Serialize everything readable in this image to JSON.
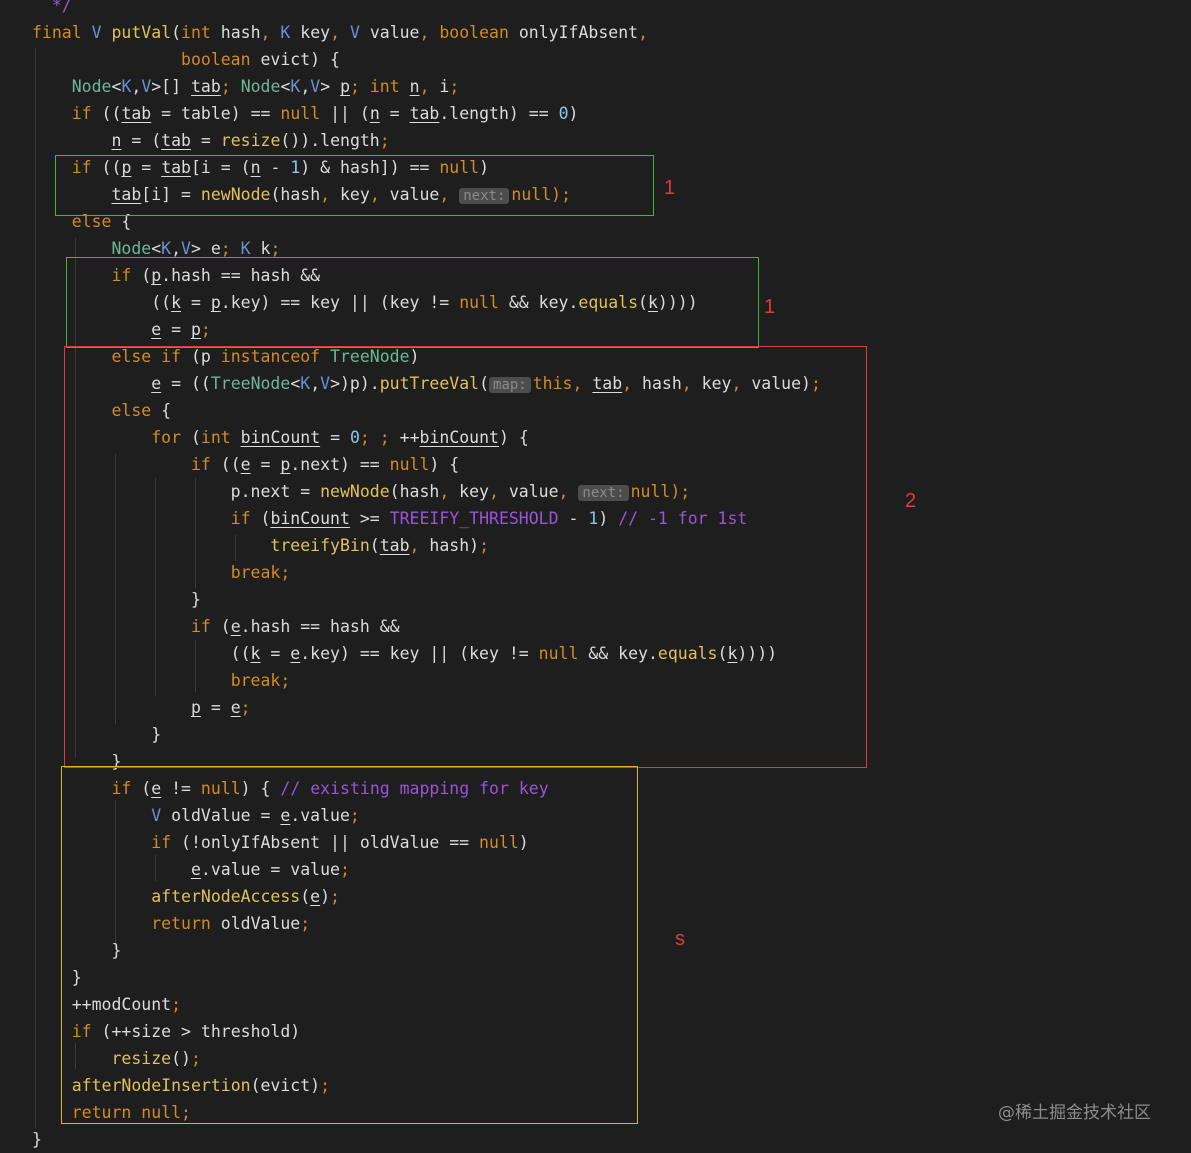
{
  "code_lines": [
    [
      {
        "t": "  */",
        "c": "cmt"
      }
    ],
    [
      {
        "t": "final",
        "c": "kw"
      },
      {
        "t": " "
      },
      {
        "t": "V",
        "c": "gen"
      },
      {
        "t": " "
      },
      {
        "t": "putVal",
        "c": "fn"
      },
      {
        "t": "("
      },
      {
        "t": "int",
        "c": "kw"
      },
      {
        "t": " hash"
      },
      {
        "t": ",",
        "c": "pun"
      },
      {
        "t": " "
      },
      {
        "t": "K",
        "c": "gen"
      },
      {
        "t": " key"
      },
      {
        "t": ",",
        "c": "pun"
      },
      {
        "t": " "
      },
      {
        "t": "V",
        "c": "gen"
      },
      {
        "t": " value"
      },
      {
        "t": ",",
        "c": "pun"
      },
      {
        "t": " "
      },
      {
        "t": "boolean",
        "c": "kw"
      },
      {
        "t": " onlyIfAbsent"
      },
      {
        "t": ",",
        "c": "pun"
      }
    ],
    [
      {
        "t": "               "
      },
      {
        "t": "boolean",
        "c": "kw"
      },
      {
        "t": " evict) {"
      }
    ],
    [
      {
        "t": "    "
      },
      {
        "t": "Node",
        "c": "ty"
      },
      {
        "t": "<"
      },
      {
        "t": "K",
        "c": "gen"
      },
      {
        "t": ","
      },
      {
        "t": "V",
        "c": "gen"
      },
      {
        "t": ">[] "
      },
      {
        "t": "tab",
        "c": "u"
      },
      {
        "t": ";",
        "c": "pun"
      },
      {
        "t": " "
      },
      {
        "t": "Node",
        "c": "ty"
      },
      {
        "t": "<"
      },
      {
        "t": "K",
        "c": "gen"
      },
      {
        "t": ","
      },
      {
        "t": "V",
        "c": "gen"
      },
      {
        "t": "> "
      },
      {
        "t": "p",
        "c": "u"
      },
      {
        "t": ";",
        "c": "pun"
      },
      {
        "t": " "
      },
      {
        "t": "int",
        "c": "kw"
      },
      {
        "t": " "
      },
      {
        "t": "n",
        "c": "u"
      },
      {
        "t": ",",
        "c": "pun"
      },
      {
        "t": " i"
      },
      {
        "t": ";",
        "c": "pun"
      }
    ],
    [
      {
        "t": "    "
      },
      {
        "t": "if",
        "c": "kw"
      },
      {
        "t": " (("
      },
      {
        "t": "tab",
        "c": "u"
      },
      {
        "t": " = table) == "
      },
      {
        "t": "null",
        "c": "kw"
      },
      {
        "t": " || ("
      },
      {
        "t": "n",
        "c": "u"
      },
      {
        "t": " = "
      },
      {
        "t": "tab",
        "c": "u"
      },
      {
        "t": ".length) == "
      },
      {
        "t": "0",
        "c": "num"
      },
      {
        "t": ")"
      }
    ],
    [
      {
        "t": "        "
      },
      {
        "t": "n",
        "c": "u"
      },
      {
        "t": " = ("
      },
      {
        "t": "tab",
        "c": "u"
      },
      {
        "t": " = "
      },
      {
        "t": "resize",
        "c": "fn"
      },
      {
        "t": "()).length"
      },
      {
        "t": ";",
        "c": "pun"
      }
    ],
    [
      {
        "t": "    "
      },
      {
        "t": "if",
        "c": "kw"
      },
      {
        "t": " (("
      },
      {
        "t": "p",
        "c": "u"
      },
      {
        "t": " = "
      },
      {
        "t": "tab",
        "c": "u"
      },
      {
        "t": "[i = ("
      },
      {
        "t": "n",
        "c": "u"
      },
      {
        "t": " - "
      },
      {
        "t": "1",
        "c": "num"
      },
      {
        "t": ") & hash]) == "
      },
      {
        "t": "null",
        "c": "kw"
      },
      {
        "t": ")"
      }
    ],
    [
      {
        "t": "        "
      },
      {
        "t": "tab",
        "c": "u"
      },
      {
        "t": "[i] = "
      },
      {
        "t": "newNode",
        "c": "fn"
      },
      {
        "t": "(hash"
      },
      {
        "t": ",",
        "c": "pun"
      },
      {
        "t": " key"
      },
      {
        "t": ",",
        "c": "pun"
      },
      {
        "t": " value"
      },
      {
        "t": ",",
        "c": "pun"
      },
      {
        "t": " "
      },
      {
        "t": "next:",
        "c": "hint"
      },
      {
        "t": "null",
        "c": "kw"
      },
      {
        "t": ");",
        "c": "pun"
      }
    ],
    [
      {
        "t": "    "
      },
      {
        "t": "else",
        "c": "kw"
      },
      {
        "t": " {"
      }
    ],
    [
      {
        "t": "        "
      },
      {
        "t": "Node",
        "c": "ty"
      },
      {
        "t": "<"
      },
      {
        "t": "K",
        "c": "gen"
      },
      {
        "t": ","
      },
      {
        "t": "V",
        "c": "gen"
      },
      {
        "t": "> "
      },
      {
        "t": "e",
        "c": "u"
      },
      {
        "t": ";",
        "c": "pun"
      },
      {
        "t": " "
      },
      {
        "t": "K",
        "c": "gen"
      },
      {
        "t": " "
      },
      {
        "t": "k",
        "c": "u"
      },
      {
        "t": ";",
        "c": "pun"
      }
    ],
    [
      {
        "t": "        "
      },
      {
        "t": "if",
        "c": "kw"
      },
      {
        "t": " ("
      },
      {
        "t": "p",
        "c": "u"
      },
      {
        "t": ".hash == hash &&"
      }
    ],
    [
      {
        "t": "            (("
      },
      {
        "t": "k",
        "c": "u"
      },
      {
        "t": " = "
      },
      {
        "t": "p",
        "c": "u"
      },
      {
        "t": ".key) == key || (key != "
      },
      {
        "t": "null",
        "c": "kw"
      },
      {
        "t": " && key."
      },
      {
        "t": "equals",
        "c": "fn"
      },
      {
        "t": "("
      },
      {
        "t": "k",
        "c": "u"
      },
      {
        "t": "))))"
      }
    ],
    [
      {
        "t": "            "
      },
      {
        "t": "e",
        "c": "u"
      },
      {
        "t": " = "
      },
      {
        "t": "p",
        "c": "u"
      },
      {
        "t": ";",
        "c": "pun"
      }
    ],
    [
      {
        "t": "        "
      },
      {
        "t": "else if",
        "c": "kw"
      },
      {
        "t": " (p "
      },
      {
        "t": "instanceof",
        "c": "kw"
      },
      {
        "t": " "
      },
      {
        "t": "TreeNode",
        "c": "ty"
      },
      {
        "t": ")"
      }
    ],
    [
      {
        "t": "            "
      },
      {
        "t": "e",
        "c": "u"
      },
      {
        "t": " = (("
      },
      {
        "t": "TreeNode",
        "c": "ty"
      },
      {
        "t": "<"
      },
      {
        "t": "K",
        "c": "gen"
      },
      {
        "t": ","
      },
      {
        "t": "V",
        "c": "gen"
      },
      {
        "t": ">)p)."
      },
      {
        "t": "putTreeVal",
        "c": "fn"
      },
      {
        "t": "("
      },
      {
        "t": "map:",
        "c": "hint"
      },
      {
        "t": "this",
        "c": "kw"
      },
      {
        "t": ",",
        "c": "pun"
      },
      {
        "t": " "
      },
      {
        "t": "tab",
        "c": "u"
      },
      {
        "t": ",",
        "c": "pun"
      },
      {
        "t": " hash"
      },
      {
        "t": ",",
        "c": "pun"
      },
      {
        "t": " key"
      },
      {
        "t": ",",
        "c": "pun"
      },
      {
        "t": " value)"
      },
      {
        "t": ";",
        "c": "pun"
      }
    ],
    [
      {
        "t": "        "
      },
      {
        "t": "else",
        "c": "kw"
      },
      {
        "t": " {"
      }
    ],
    [
      {
        "t": "            "
      },
      {
        "t": "for",
        "c": "kw"
      },
      {
        "t": " ("
      },
      {
        "t": "int",
        "c": "kw"
      },
      {
        "t": " "
      },
      {
        "t": "binCount",
        "c": "u"
      },
      {
        "t": " = "
      },
      {
        "t": "0",
        "c": "num"
      },
      {
        "t": ";",
        "c": "pun"
      },
      {
        "t": " ",
        "c": ""
      },
      {
        "t": ";",
        "c": "pun"
      },
      {
        "t": " ++"
      },
      {
        "t": "binCount",
        "c": "u"
      },
      {
        "t": ") {"
      }
    ],
    [
      {
        "t": "                "
      },
      {
        "t": "if",
        "c": "kw"
      },
      {
        "t": " (("
      },
      {
        "t": "e",
        "c": "u"
      },
      {
        "t": " = "
      },
      {
        "t": "p",
        "c": "u"
      },
      {
        "t": ".next) == "
      },
      {
        "t": "null",
        "c": "kw"
      },
      {
        "t": ") {"
      }
    ],
    [
      {
        "t": "                    p.next = "
      },
      {
        "t": "newNode",
        "c": "fn"
      },
      {
        "t": "(hash"
      },
      {
        "t": ",",
        "c": "pun"
      },
      {
        "t": " key"
      },
      {
        "t": ",",
        "c": "pun"
      },
      {
        "t": " value"
      },
      {
        "t": ",",
        "c": "pun"
      },
      {
        "t": " "
      },
      {
        "t": "next:",
        "c": "hint"
      },
      {
        "t": "null",
        "c": "kw"
      },
      {
        "t": ");",
        "c": "pun"
      }
    ],
    [
      {
        "t": "                    "
      },
      {
        "t": "if",
        "c": "kw"
      },
      {
        "t": " ("
      },
      {
        "t": "binCount",
        "c": "u"
      },
      {
        "t": " >= "
      },
      {
        "t": "TREEIFY_THRESHOLD",
        "c": "cmt"
      },
      {
        "t": " - "
      },
      {
        "t": "1",
        "c": "num"
      },
      {
        "t": ") "
      },
      {
        "t": "// -1 for 1st",
        "c": "cmt"
      }
    ],
    [
      {
        "t": "                        "
      },
      {
        "t": "treeifyBin",
        "c": "fn"
      },
      {
        "t": "("
      },
      {
        "t": "tab",
        "c": "u"
      },
      {
        "t": ",",
        "c": "pun"
      },
      {
        "t": " hash)"
      },
      {
        "t": ";",
        "c": "pun"
      }
    ],
    [
      {
        "t": "                    "
      },
      {
        "t": "break",
        "c": "kw"
      },
      {
        "t": ";",
        "c": "pun"
      }
    ],
    [
      {
        "t": "                }"
      }
    ],
    [
      {
        "t": "                "
      },
      {
        "t": "if",
        "c": "kw"
      },
      {
        "t": " ("
      },
      {
        "t": "e",
        "c": "u"
      },
      {
        "t": ".hash == hash &&"
      }
    ],
    [
      {
        "t": "                    (("
      },
      {
        "t": "k",
        "c": "u"
      },
      {
        "t": " = "
      },
      {
        "t": "e",
        "c": "u"
      },
      {
        "t": ".key) == key || (key != "
      },
      {
        "t": "null",
        "c": "kw"
      },
      {
        "t": " && key."
      },
      {
        "t": "equals",
        "c": "fn"
      },
      {
        "t": "("
      },
      {
        "t": "k",
        "c": "u"
      },
      {
        "t": "))))"
      }
    ],
    [
      {
        "t": "                    "
      },
      {
        "t": "break",
        "c": "kw"
      },
      {
        "t": ";",
        "c": "pun"
      }
    ],
    [
      {
        "t": "                "
      },
      {
        "t": "p",
        "c": "u"
      },
      {
        "t": " = "
      },
      {
        "t": "e",
        "c": "u"
      },
      {
        "t": ";",
        "c": "pun"
      }
    ],
    [
      {
        "t": "            }"
      }
    ],
    [
      {
        "t": "        }"
      }
    ],
    [
      {
        "t": "        "
      },
      {
        "t": "if",
        "c": "kw"
      },
      {
        "t": " ("
      },
      {
        "t": "e",
        "c": "u"
      },
      {
        "t": " != "
      },
      {
        "t": "null",
        "c": "kw"
      },
      {
        "t": ") { "
      },
      {
        "t": "// existing mapping for key",
        "c": "cmt"
      }
    ],
    [
      {
        "t": "            "
      },
      {
        "t": "V",
        "c": "gen"
      },
      {
        "t": " oldValue = "
      },
      {
        "t": "e",
        "c": "u"
      },
      {
        "t": ".value"
      },
      {
        "t": ";",
        "c": "pun"
      }
    ],
    [
      {
        "t": "            "
      },
      {
        "t": "if",
        "c": "kw"
      },
      {
        "t": " (!onlyIfAbsent || oldValue == "
      },
      {
        "t": "null",
        "c": "kw"
      },
      {
        "t": ")"
      }
    ],
    [
      {
        "t": "                "
      },
      {
        "t": "e",
        "c": "u"
      },
      {
        "t": ".value = value"
      },
      {
        "t": ";",
        "c": "pun"
      }
    ],
    [
      {
        "t": "            "
      },
      {
        "t": "afterNodeAccess",
        "c": "fn"
      },
      {
        "t": "("
      },
      {
        "t": "e",
        "c": "u"
      },
      {
        "t": ")"
      },
      {
        "t": ";",
        "c": "pun"
      }
    ],
    [
      {
        "t": "            "
      },
      {
        "t": "return",
        "c": "kw"
      },
      {
        "t": " oldValue"
      },
      {
        "t": ";",
        "c": "pun"
      }
    ],
    [
      {
        "t": "        }"
      }
    ],
    [
      {
        "t": "    }"
      }
    ],
    [
      {
        "t": "    ++modCount"
      },
      {
        "t": ";",
        "c": "pun"
      }
    ],
    [
      {
        "t": "    "
      },
      {
        "t": "if",
        "c": "kw"
      },
      {
        "t": " (++size > threshold)"
      }
    ],
    [
      {
        "t": "        "
      },
      {
        "t": "resize",
        "c": "fn"
      },
      {
        "t": "()"
      },
      {
        "t": ";",
        "c": "pun"
      }
    ],
    [
      {
        "t": "    "
      },
      {
        "t": "afterNodeInsertion",
        "c": "fn"
      },
      {
        "t": "(evict)"
      },
      {
        "t": ";",
        "c": "pun"
      }
    ],
    [
      {
        "t": "    "
      },
      {
        "t": "return",
        "c": "kw"
      },
      {
        "t": " "
      },
      {
        "t": "null",
        "c": "kw"
      },
      {
        "t": ";",
        "c": "pun"
      }
    ],
    [
      {
        "t": "}"
      }
    ]
  ],
  "annotations": {
    "box1a_label": "1",
    "box1b_label": "1",
    "box2_label": "2",
    "box3_label": "s",
    "colors": {
      "green": "#3fb53f",
      "red": "#e03a3a",
      "yellow": "#e0b020"
    }
  },
  "watermark": "@稀土掘金技术社区"
}
